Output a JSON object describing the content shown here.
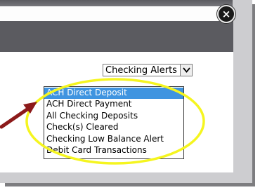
{
  "dialog": {
    "close_icon_glyph": "×"
  },
  "alert_select": {
    "selected_label": "Checking Alerts",
    "arrow_glyph": "▾"
  },
  "options": [
    "ACH Direct Deposit",
    "ACH Direct Payment",
    "All Checking Deposits",
    "Check(s) Cleared",
    "Checking Low Balance Alert",
    "Debit Card Transactions"
  ],
  "selected_option_index": 0,
  "colors": {
    "highlight_yellow": "#f5f51f",
    "pointer_arrow": "#8c1a1a",
    "selection_blue": "#3f94e0"
  }
}
